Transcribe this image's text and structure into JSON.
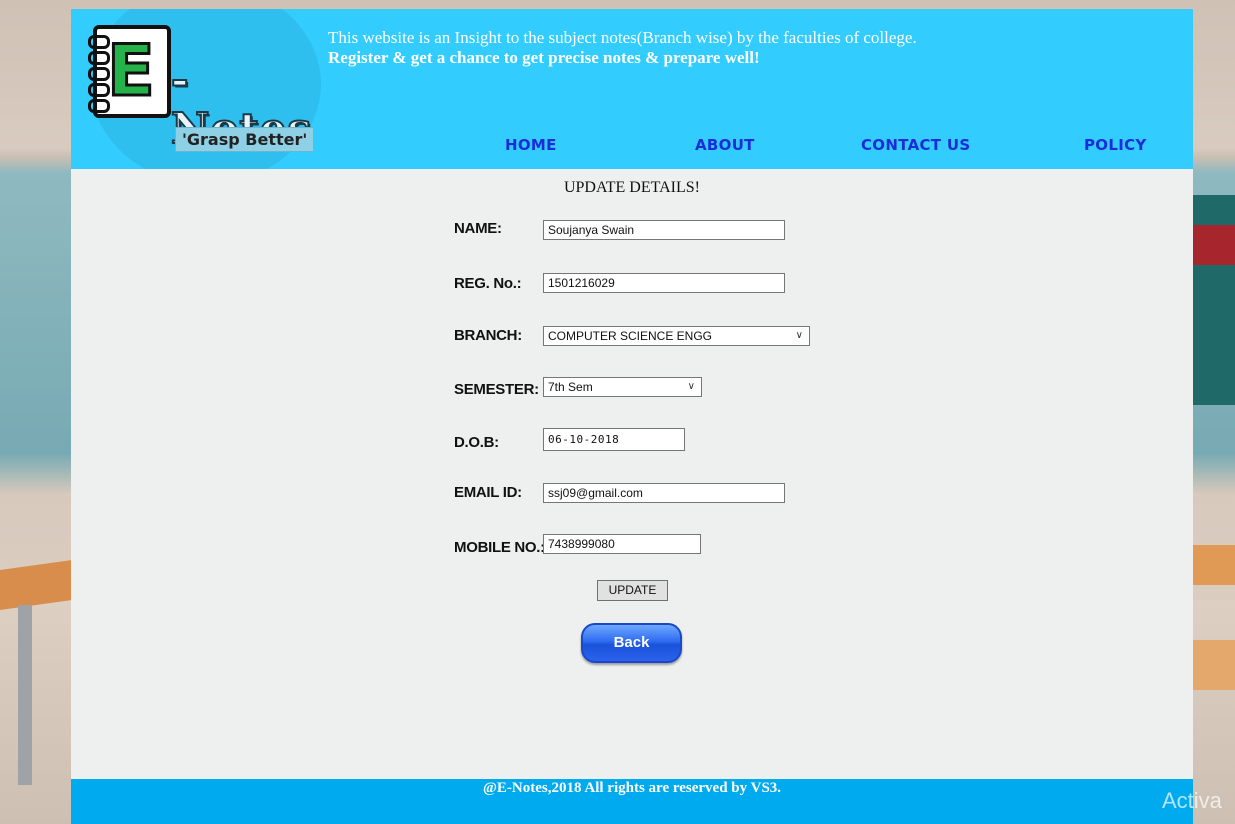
{
  "header": {
    "logo_text": "E-Notes",
    "logo_letter": "E",
    "logo_suffix": "-Notes",
    "tagline": "'Grasp Better'",
    "intro_line1": "This website is an Insight to the subject notes(Branch wise) by the faculties of college.",
    "intro_line2": "Register & get a chance to get precise notes & prepare well!"
  },
  "nav": {
    "home": "HOME",
    "about": "ABOUT",
    "contact": "CONTACT US",
    "policy": "POLICY"
  },
  "form": {
    "heading": "UPDATE DETAILS!",
    "name_label": "NAME:",
    "name_value": "Soujanya Swain",
    "reg_label": "REG. No.:",
    "reg_value": "1501216029",
    "branch_label": "BRANCH:",
    "branch_value": "COMPUTER SCIENCE ENGG",
    "semester_label": "SEMESTER:",
    "semester_value": "7th Sem",
    "dob_label": "D.O.B:",
    "dob_value": "06-10-2018",
    "email_label": "EMAIL ID:",
    "email_value": "ssj09@gmail.com",
    "mobile_label": "MOBILE NO.:",
    "mobile_value": "7438999080",
    "update_label": "UPDATE",
    "back_label": "Back"
  },
  "footer": {
    "text": "@E-Notes,2018 All rights are reserved by VS3."
  },
  "watermark": "Activa",
  "colors": {
    "header_bg": "#33ccff",
    "nav_link": "#1a2dd8",
    "footer_bg": "#00aaee",
    "back_button": "#2e6cf2"
  }
}
